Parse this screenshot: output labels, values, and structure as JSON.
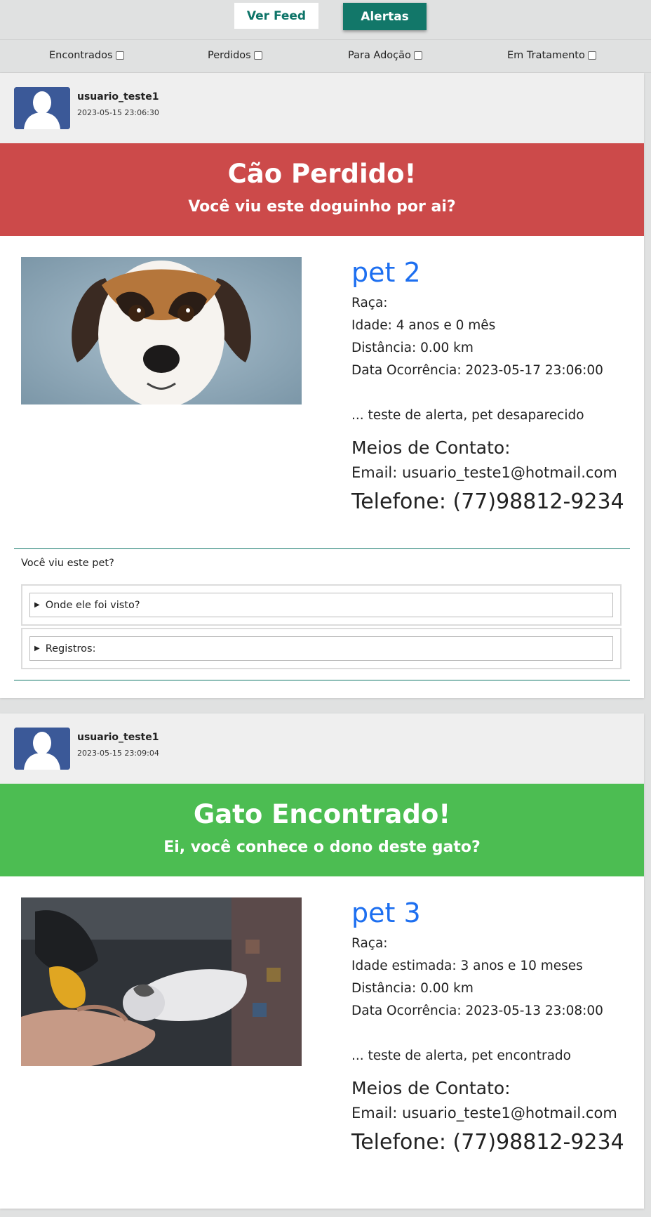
{
  "nav": {
    "feed_label": "Ver Feed",
    "alerts_label": "Alertas"
  },
  "filters": [
    {
      "label": "Encontrados"
    },
    {
      "label": "Perdidos"
    },
    {
      "label": "Para Adoção"
    },
    {
      "label": "Em Tratamento"
    }
  ],
  "posts": [
    {
      "username": "usuario_teste1",
      "timestamp": "2023-05-15 23:06:30",
      "banner_title": "Cão Perdido!",
      "banner_subtitle": "Você viu este doguinho por ai?",
      "banner_color": "#cc4a4a",
      "pet_name": "pet 2",
      "breed": "Raça:",
      "age": "Idade: 4 anos e 0 mês",
      "distance": "Distância: 0.00 km",
      "date": "Data Ocorrência: 2023-05-17 23:06:00",
      "description": "... teste de alerta, pet desaparecido",
      "contact_title": "Meios de Contato:",
      "email": "Email: usuario_teste1@hotmail.com",
      "phone": "Telefone: (77)98812-9234",
      "sighting_question": "Você viu este pet?",
      "where_seen": "Onde ele foi visto?",
      "records": "Registros:"
    },
    {
      "username": "usuario_teste1",
      "timestamp": "2023-05-15 23:09:04",
      "banner_title": "Gato Encontrado!",
      "banner_subtitle": "Ei, você conhece o dono deste gato?",
      "banner_color": "#4cbd52",
      "pet_name": "pet 3",
      "breed": "Raça:",
      "age": "Idade estimada: 3 anos e 10 meses",
      "distance": "Distância: 0.00 km",
      "date": "Data Ocorrência: 2023-05-13 23:08:00",
      "description": "... teste de alerta, pet encontrado",
      "contact_title": "Meios de Contato:",
      "email": "Email: usuario_teste1@hotmail.com",
      "phone": "Telefone: (77)98812-9234"
    }
  ],
  "colors": {
    "accent": "#127769",
    "pet_name": "#1d6ff0"
  }
}
